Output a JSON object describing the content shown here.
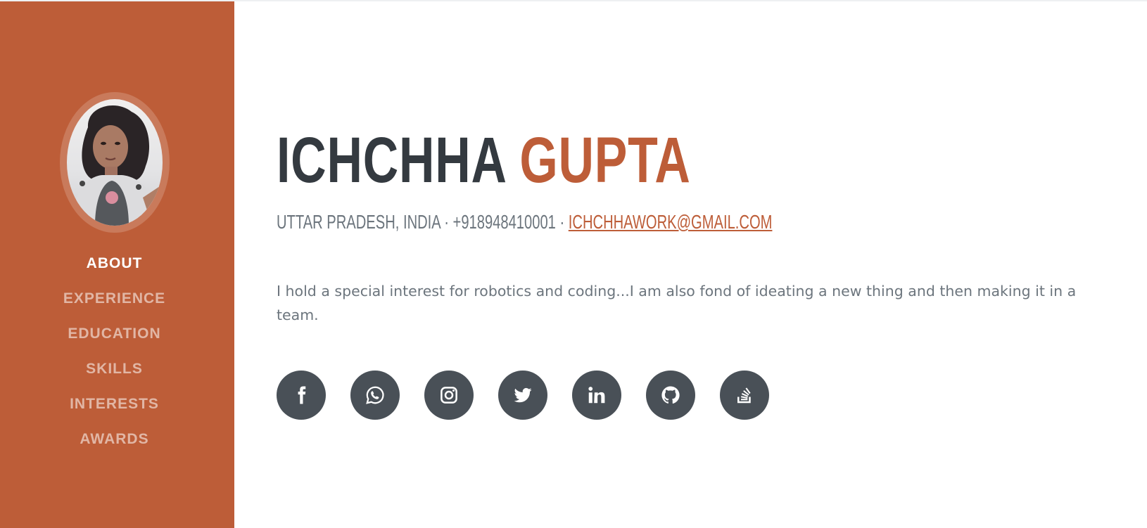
{
  "profile": {
    "first_name": "ICHCHHA",
    "last_name": "GUPTA",
    "location": "UTTAR PRADESH, INDIA",
    "separator": "·",
    "phone": "+918948410001",
    "email": "ICHCHHAWORK@GMAIL.COM",
    "about": "I hold a special interest for robotics and coding...I am also fond of ideating a new thing and then making it in a team."
  },
  "sidebar": {
    "nav": [
      {
        "label": "ABOUT",
        "active": true
      },
      {
        "label": "EXPERIENCE",
        "active": false
      },
      {
        "label": "EDUCATION",
        "active": false
      },
      {
        "label": "SKILLS",
        "active": false
      },
      {
        "label": "INTERESTS",
        "active": false
      },
      {
        "label": "AWARDS",
        "active": false
      }
    ]
  },
  "social": [
    {
      "icon": "facebook-icon"
    },
    {
      "icon": "whatsapp-icon"
    },
    {
      "icon": "instagram-icon"
    },
    {
      "icon": "twitter-icon"
    },
    {
      "icon": "linkedin-icon"
    },
    {
      "icon": "github-icon"
    },
    {
      "icon": "stackoverflow-icon"
    }
  ],
  "colors": {
    "primary": "#bd5d38",
    "heading": "#343a40",
    "muted": "#6c757d",
    "social_button": "#495057"
  }
}
